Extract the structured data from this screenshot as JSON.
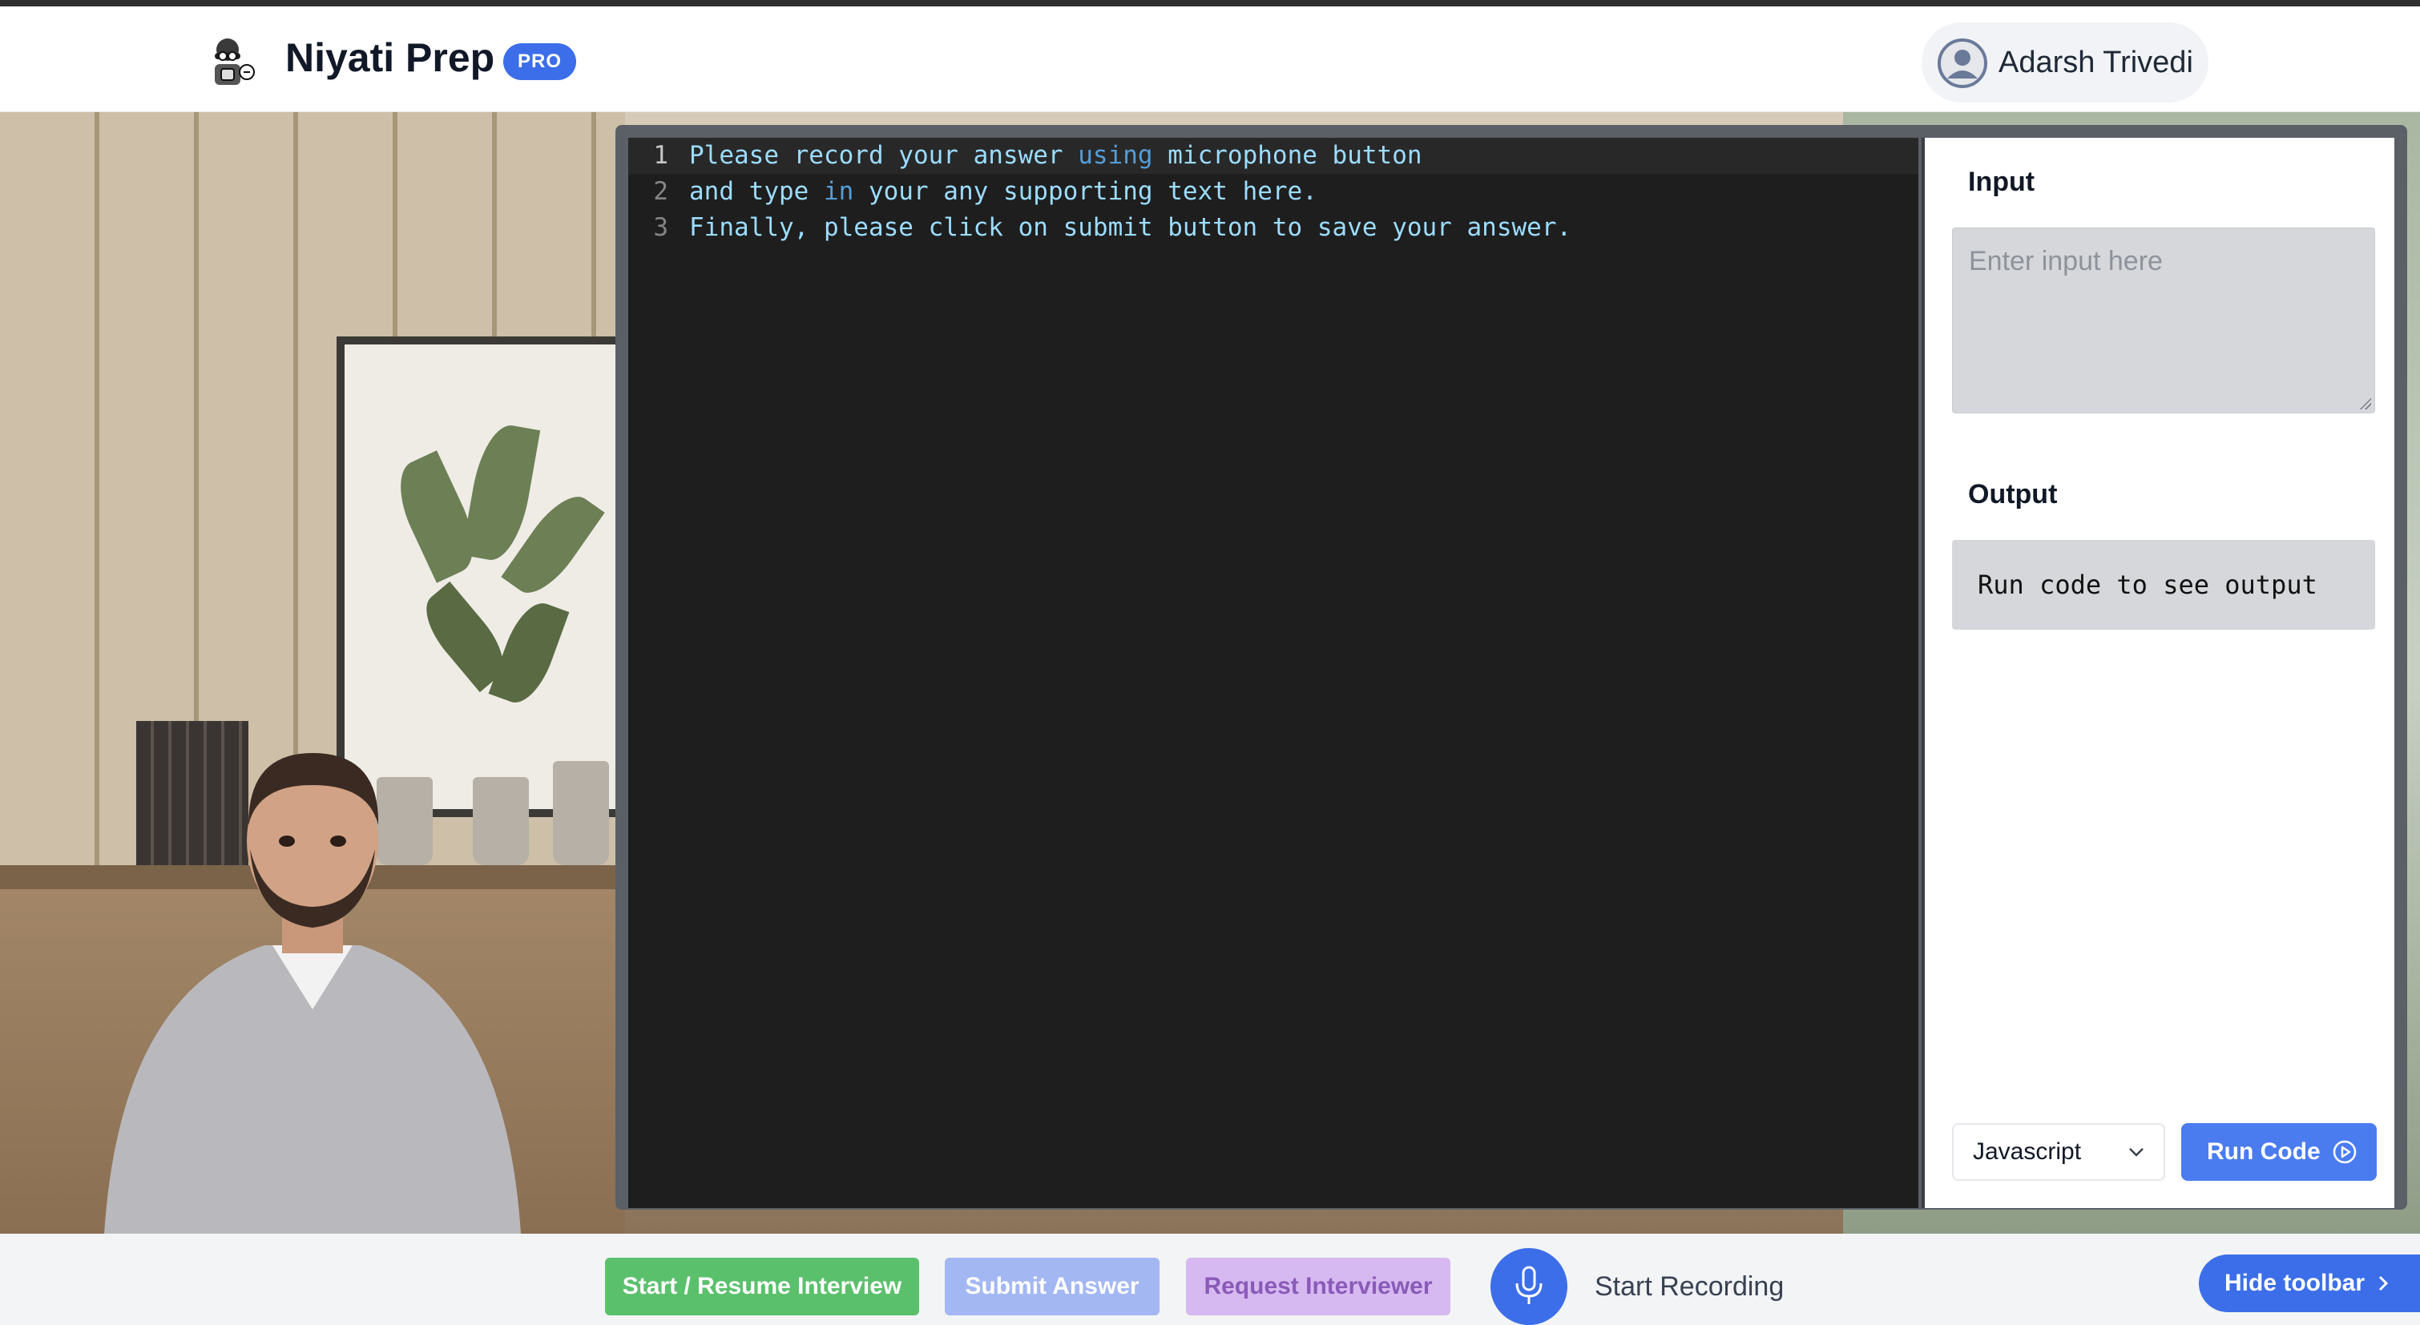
{
  "header": {
    "brand": "Niyati Prep",
    "badge": "PRO",
    "user_name": "Adarsh Trivedi",
    "logo_icon": "spy-mascot-icon",
    "avatar_icon": "user-avatar-icon"
  },
  "editor": {
    "lines": [
      {
        "number": "1",
        "segments": [
          {
            "text": "Please record your answer "
          },
          {
            "text": "using",
            "kw": true
          },
          {
            "text": " microphone button"
          }
        ]
      },
      {
        "number": "2",
        "segments": [
          {
            "text": "and type "
          },
          {
            "text": "in",
            "kw": true
          },
          {
            "text": " your any supporting text here."
          }
        ]
      },
      {
        "number": "3",
        "segments": [
          {
            "text": "Finally, please click on submit button to save your answer."
          }
        ]
      }
    ]
  },
  "panel": {
    "input_label": "Input",
    "input_placeholder": "Enter input here",
    "output_label": "Output",
    "output_text": "Run code to see output",
    "language": "Javascript",
    "run_label": "Run Code"
  },
  "toolbar": {
    "start_label": "Start / Resume Interview",
    "submit_label": "Submit Answer",
    "request_label": "Request Interviewer",
    "record_label": "Start Recording",
    "hide_label": "Hide toolbar"
  },
  "colors": {
    "accent": "#3b6ee8",
    "start_green": "#5bc06c",
    "editor_bg": "#1e1e1e",
    "keyword": "#569cd6",
    "code_text": "#9cdcfe"
  }
}
